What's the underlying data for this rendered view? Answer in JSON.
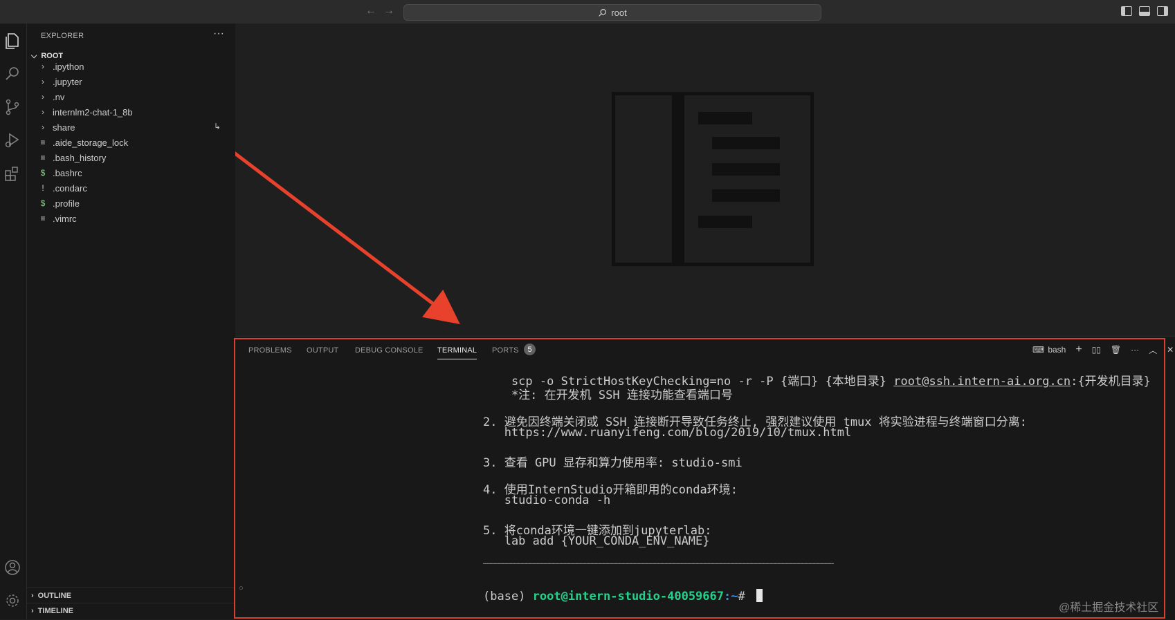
{
  "titlebar": {
    "back_icon": "arrow-left",
    "forward_icon": "arrow-right",
    "search_text": "root"
  },
  "sidebar": {
    "title": "EXPLORER",
    "more": "···",
    "root_label": "ROOT",
    "items": [
      {
        "label": ".ipython",
        "type": "folder"
      },
      {
        "label": ".jupyter",
        "type": "folder"
      },
      {
        "label": ".nv",
        "type": "folder"
      },
      {
        "label": "internlm2-chat-1_8b",
        "type": "folder"
      },
      {
        "label": "share",
        "type": "folder"
      },
      {
        "label": ".aide_storage_lock",
        "type": "file"
      },
      {
        "label": ".bash_history",
        "type": "file"
      },
      {
        "label": ".bashrc",
        "type": "shell"
      },
      {
        "label": ".condarc",
        "type": "yaml"
      },
      {
        "label": ".profile",
        "type": "shell"
      },
      {
        "label": ".vimrc",
        "type": "file"
      }
    ],
    "outline_label": "OUTLINE",
    "timeline_label": "TIMELINE"
  },
  "panel": {
    "tabs": [
      "PROBLEMS",
      "OUTPUT",
      "DEBUG CONSOLE",
      "TERMINAL",
      "PORTS"
    ],
    "active_tab": "TERMINAL",
    "ports_count": "5",
    "terminal_name": "bash"
  },
  "terminal": {
    "line1_pre": "    scp -o StrictHostKeyChecking=no -r -P {端口} {本地目录} ",
    "line1_link": "root@ssh.intern-ai.org.cn",
    "line1_post": ":{开发机目录}",
    "line2": "    *注: 在开发机 SSH 连接功能查看端口号",
    "line3": "2. 避免因终端关闭或 SSH 连接断开导致任务终止, 强烈建议使用 tmux 将实验进程与终端窗口分离:",
    "line4": "   https://www.ruanyifeng.com/blog/2019/10/tmux.html",
    "line5": "3. 查看 GPU 显存和算力使用率: studio-smi",
    "line6": "4. 使用InternStudio开箱即用的conda环境:",
    "line7": "   studio-conda -h",
    "line8": "5. 将conda环境一键添加到jupyterlab:",
    "line9": "   lab add {YOUR_CONDA_ENV_NAME}",
    "separator": "——————————————————————————————————————————————————————————————————————————————————————————",
    "prompt_env": "(base) ",
    "prompt_user": "root@intern-studio-40059667",
    "prompt_path": ":~",
    "prompt_symbol": "# "
  },
  "watermark": "@稀土掘金技术社区",
  "colors": {
    "annotation_red": "#d9412f",
    "accent_blue": "#0078d4"
  }
}
